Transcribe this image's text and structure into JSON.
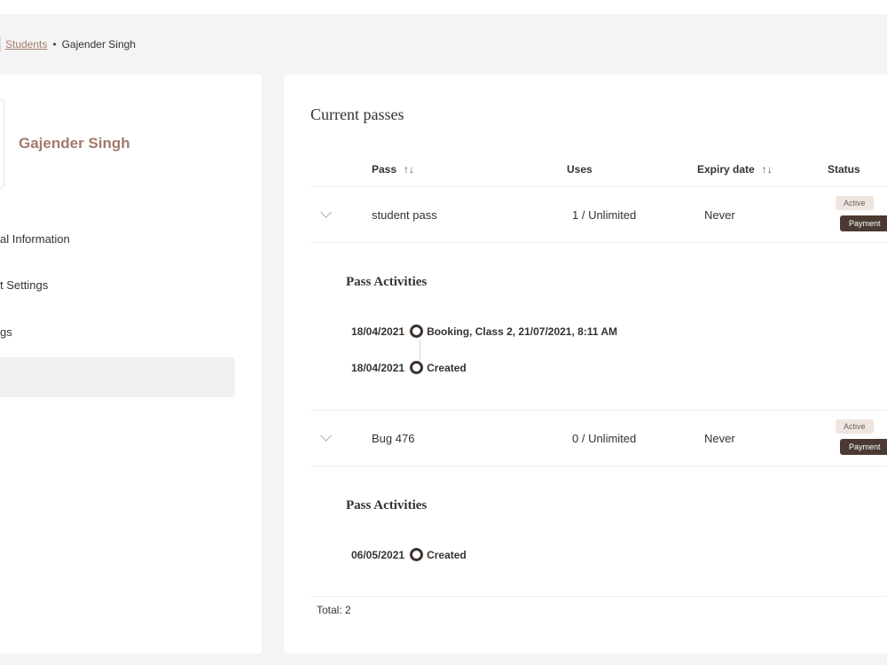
{
  "breadcrumb": {
    "link": "Students",
    "separator": "•",
    "current": "Gajender Singh"
  },
  "profile": {
    "name": "Gajender Singh"
  },
  "menu": {
    "items": [
      "al Information",
      "t Settings",
      "gs"
    ]
  },
  "passes": {
    "title": "Current passes",
    "columns": {
      "pass": "Pass",
      "uses": "Uses",
      "expiry": "Expiry date",
      "status": "Status",
      "sort_icon": "↑↓"
    },
    "rows": [
      {
        "name": "student pass",
        "uses": "1 / Unlimited",
        "expiry": "Never",
        "badge_status": "Active",
        "badge_payment": "Payment",
        "activities_title": "Pass Activities",
        "activities": [
          {
            "date": "18/04/2021",
            "text": "Booking, Class 2, 21/07/2021, 8:11 AM"
          },
          {
            "date": "18/04/2021",
            "text": "Created"
          }
        ]
      },
      {
        "name": "Bug 476",
        "uses": "0 / Unlimited",
        "expiry": "Never",
        "badge_status": "Active",
        "badge_payment": "Payment",
        "activities_title": "Pass Activities",
        "activities": [
          {
            "date": "06/05/2021",
            "text": "Created"
          }
        ]
      }
    ],
    "total": "Total: 2"
  },
  "colors": {
    "accent": "#a47a6c",
    "badge_active_bg": "#efe5df",
    "badge_payment_bg": "#4b3a32",
    "timeline_circle": "#3f332c"
  }
}
